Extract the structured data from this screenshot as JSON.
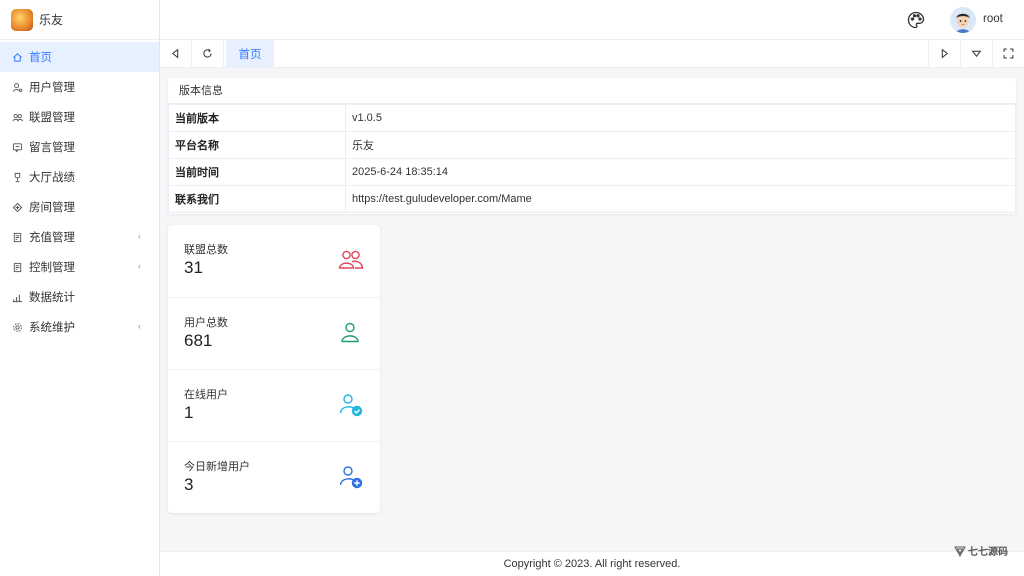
{
  "app": {
    "name": "乐友"
  },
  "sidebar": {
    "items": [
      {
        "label": "首页",
        "icon": "home-icon",
        "active": true
      },
      {
        "label": "用户管理",
        "icon": "user-icon"
      },
      {
        "label": "联盟管理",
        "icon": "users-icon"
      },
      {
        "label": "留言管理",
        "icon": "message-icon"
      },
      {
        "label": "大厅战绩",
        "icon": "trophy-icon"
      },
      {
        "label": "房间管理",
        "icon": "room-icon"
      },
      {
        "label": "充值管理",
        "icon": "recharge-icon",
        "expandable": true
      },
      {
        "label": "控制管理",
        "icon": "control-icon",
        "expandable": true
      },
      {
        "label": "数据统计",
        "icon": "chart-icon"
      },
      {
        "label": "系统维护",
        "icon": "settings-icon",
        "expandable": true
      }
    ]
  },
  "header": {
    "username": "root"
  },
  "tabs": [
    {
      "label": "首页",
      "active": true
    }
  ],
  "version_card": {
    "title": "版本信息",
    "rows": [
      {
        "key": "当前版本",
        "value": "v1.0.5"
      },
      {
        "key": "平台名称",
        "value": "乐友"
      },
      {
        "key": "当前时间",
        "value": "2025-6-24 18:35:14"
      },
      {
        "key": "联系我们",
        "value": "https://test.guludeveloper.com/Mame"
      }
    ]
  },
  "stats": [
    {
      "label": "联盟总数",
      "value": "31",
      "icon": "group-icon",
      "color": "#e0455a"
    },
    {
      "label": "用户总数",
      "value": "681",
      "icon": "user-icon",
      "color": "#1f9d6b"
    },
    {
      "label": "在线用户",
      "value": "1",
      "icon": "user-check-icon",
      "color": "#22b6e0"
    },
    {
      "label": "今日新增用户",
      "value": "3",
      "icon": "user-add-icon",
      "color": "#2f6fe0"
    }
  ],
  "footer": {
    "copyright": "Copyright © 2023. All right reserved."
  },
  "watermark": {
    "text": "七七源码"
  },
  "colors": {
    "accent": "#3a7afe",
    "active_bg": "#e6f0ff"
  }
}
